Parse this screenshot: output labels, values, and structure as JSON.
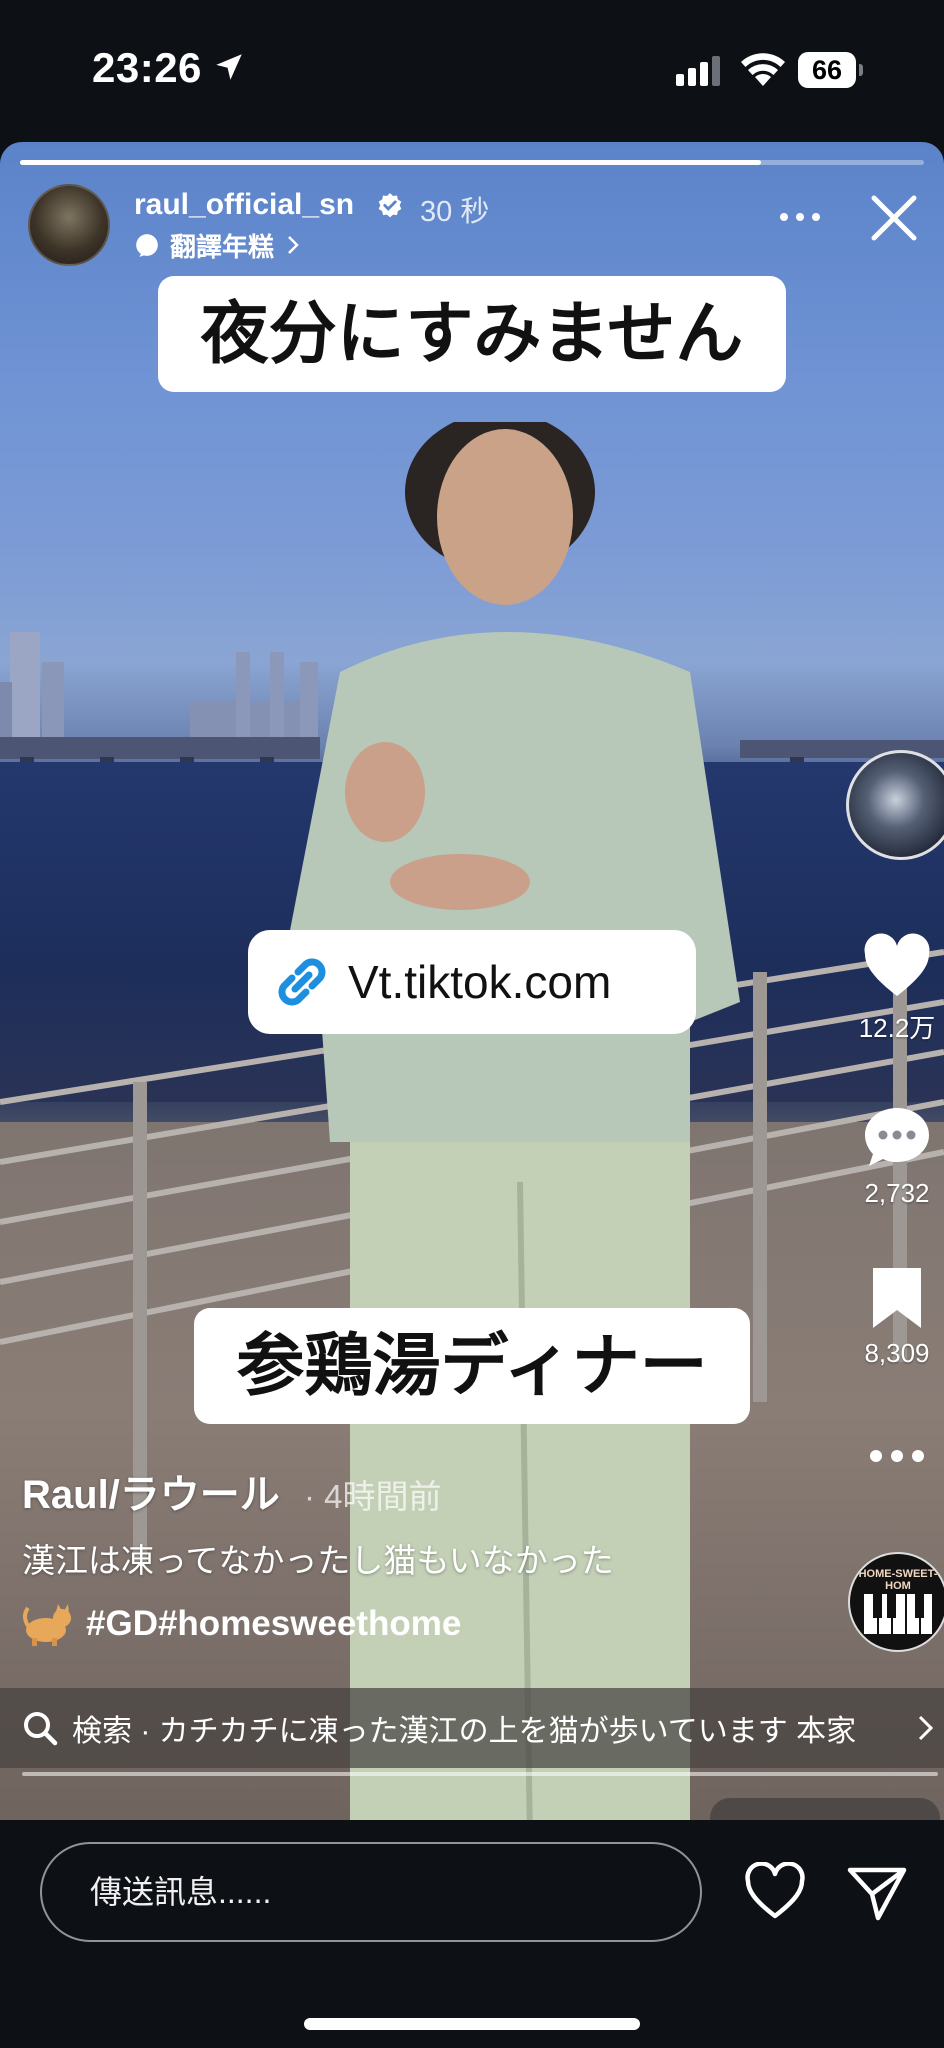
{
  "status_bar": {
    "time": "23:26",
    "battery": "66"
  },
  "story": {
    "progress": 0.82,
    "username": "raul_official_sn",
    "time_ago": "30 秒",
    "audio_label": "翻譯年糕",
    "caption_top": "夜分にすみません",
    "link_sticker": "Vt.tiktok.com",
    "caption_bottom": "参鶏湯ディナー",
    "tiktok": {
      "likes": "12.2万",
      "comments": "2,732",
      "saves": "8,309",
      "author": "Raul/ラウール",
      "posted": "· 4時間前",
      "description": "漢江は凍ってなかったし猫もいなかった",
      "hashtags": "#GD#homesweethome",
      "music_disc_label": "HOME-SWEET-HOM",
      "search_text": "検索 · カチカチに凍った漢江の上を猫が歩いています 本家"
    }
  },
  "compose": {
    "placeholder": "傳送訊息......"
  },
  "icons": {
    "location": "location-arrow-icon",
    "verified": "verified-badge-icon",
    "audio": "audio-icon",
    "more": "more-icon",
    "close": "close-icon",
    "link": "link-icon",
    "heart": "heart-icon",
    "comment": "comment-icon",
    "bookmark": "bookmark-icon",
    "search": "search-icon",
    "send": "send-icon"
  }
}
